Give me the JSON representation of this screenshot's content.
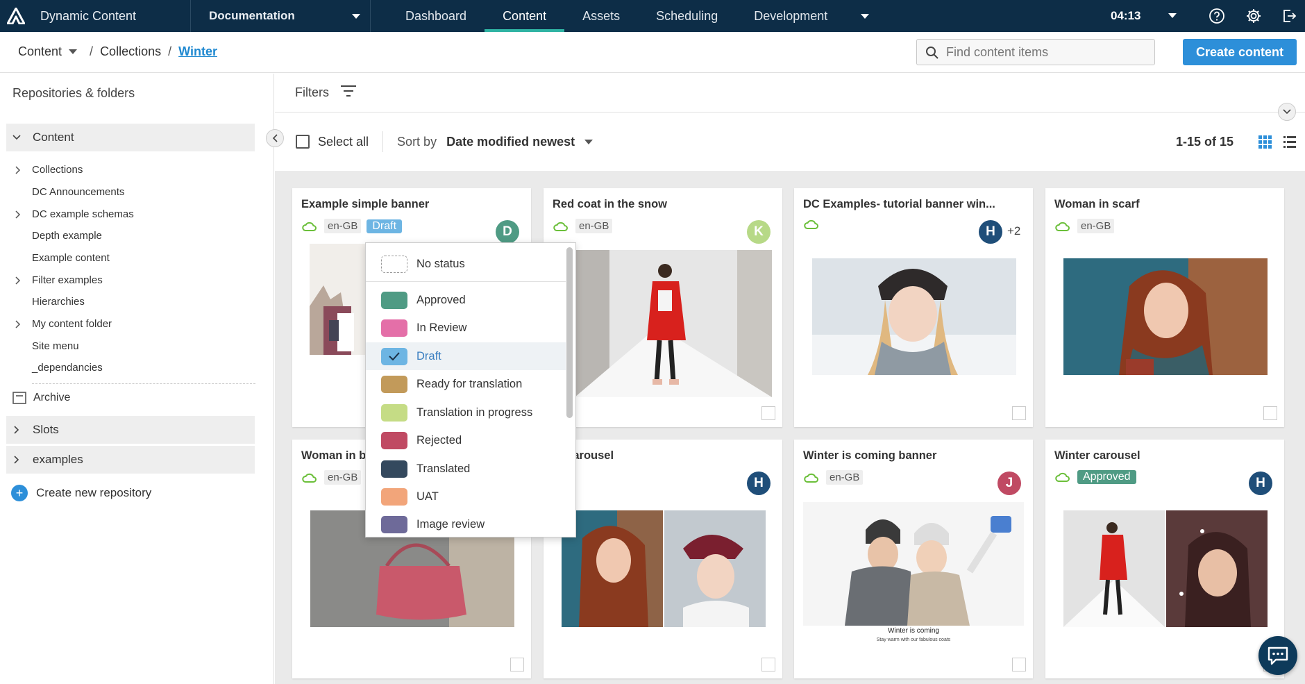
{
  "app": {
    "title": "Dynamic Content"
  },
  "nav": {
    "hub": "Documentation",
    "tabs": [
      "Dashboard",
      "Content",
      "Assets",
      "Scheduling",
      "Development"
    ],
    "time": "04:13"
  },
  "breadcrumb": {
    "root": "Content",
    "level2": "Collections",
    "current": "Winter"
  },
  "search": {
    "placeholder": "Find content items"
  },
  "create_button": "Create content",
  "sidebar": {
    "title": "Repositories & folders",
    "content_section": "Content",
    "items": [
      {
        "label": "Collections",
        "expandable": true
      },
      {
        "label": "DC Announcements",
        "expandable": false
      },
      {
        "label": "DC example schemas",
        "expandable": true
      },
      {
        "label": "Depth example",
        "expandable": false
      },
      {
        "label": "Example content",
        "expandable": false
      },
      {
        "label": "Filter examples",
        "expandable": true
      },
      {
        "label": "Hierarchies",
        "expandable": false
      },
      {
        "label": "My content folder",
        "expandable": true
      },
      {
        "label": "Site menu",
        "expandable": false
      },
      {
        "label": "_dependancies",
        "expandable": false
      }
    ],
    "archive": "Archive",
    "sections": [
      "Slots",
      "examples"
    ],
    "create_repo": "Create new repository"
  },
  "filters": {
    "label": "Filters"
  },
  "toolbar": {
    "select_all": "Select all",
    "sort_label": "Sort by",
    "sort_value": "Date modified newest",
    "count": "1-15 of 15"
  },
  "cards": [
    {
      "title": "Example simple banner",
      "locale": "en-GB",
      "status": "Draft",
      "avatar": "D"
    },
    {
      "title": "Red coat in the snow",
      "locale": "en-GB",
      "status": "",
      "avatar": "K"
    },
    {
      "title": "DC Examples- tutorial banner win...",
      "locale": "",
      "status": "",
      "avatar": "H",
      "extra": "+2"
    },
    {
      "title": "Woman in scarf",
      "locale": "en-GB",
      "status": "",
      "avatar": ""
    },
    {
      "title": "Woman in be",
      "locale": "en-GB",
      "status": "",
      "avatar": ""
    },
    {
      "title": "er carousel",
      "locale": "",
      "status": "",
      "avatar": "H"
    },
    {
      "title": "Winter is coming banner",
      "locale": "en-GB",
      "status": "",
      "avatar": "J",
      "banner_title": "Winter is coming",
      "banner_sub": "Stay warm with our fabulous coats"
    },
    {
      "title": "Winter carousel",
      "locale": "",
      "status": "Approved",
      "avatar": "H"
    }
  ],
  "status_menu": {
    "items": [
      {
        "label": "No status",
        "color": "none"
      },
      {
        "label": "Approved",
        "color": "#4f9b84"
      },
      {
        "label": "In Review",
        "color": "#e46fa8"
      },
      {
        "label": "Draft",
        "color": "#6db5e3",
        "selected": true
      },
      {
        "label": "Ready for translation",
        "color": "#c29a5a"
      },
      {
        "label": "Translation in progress",
        "color": "#c5dc85"
      },
      {
        "label": "Rejected",
        "color": "#c04a63"
      },
      {
        "label": "Translated",
        "color": "#34495e"
      },
      {
        "label": "UAT",
        "color": "#f2a57a"
      },
      {
        "label": "Image review",
        "color": "#6e6a99"
      }
    ]
  },
  "colors": {
    "nav_bg": "#0d2d47",
    "accent": "#2d8fd9",
    "tab_underline": "#2fb3a3",
    "draft": "#6db5e3",
    "approved": "#4f9b84",
    "cloud": "#6bbf3a"
  }
}
